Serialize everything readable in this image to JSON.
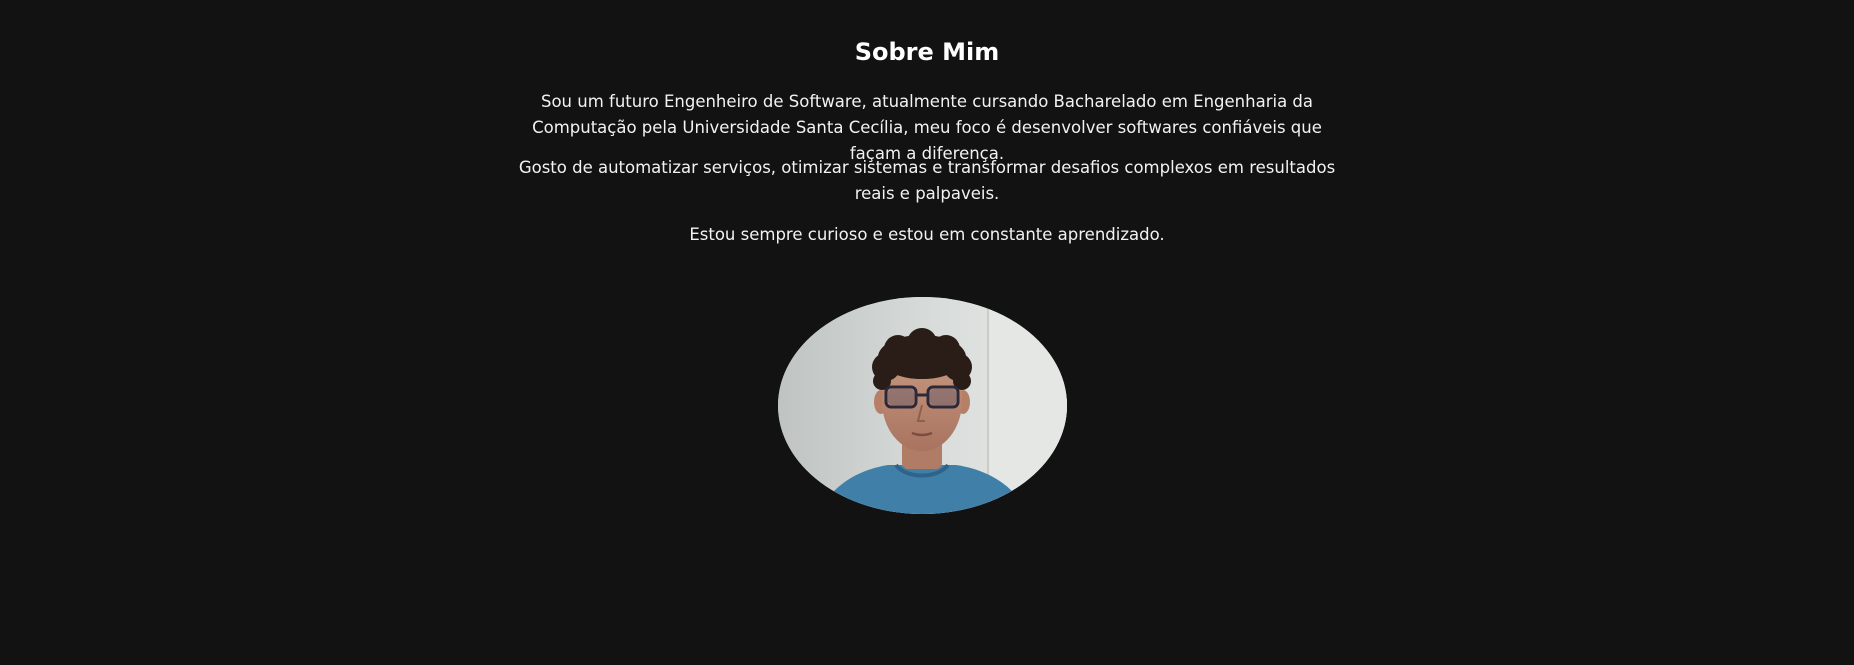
{
  "about": {
    "title": "Sobre Mim",
    "paragraphs": [
      "Sou um futuro Engenheiro de Software, atualmente cursando Bacharelado em Engenharia da Computação pela Universidade Santa Cecília, meu foco é desenvolver softwares confiáveis que façam a diferença.",
      "Gosto de automatizar serviços, otimizar sistemas e transformar desafios complexos em resultados reais e palpaveis.",
      "Estou sempre curioso e estou em constante aprendizado."
    ]
  },
  "colors": {
    "background": "#121212",
    "text": "#f2f2f2",
    "shirt": "#3f7fa8"
  }
}
